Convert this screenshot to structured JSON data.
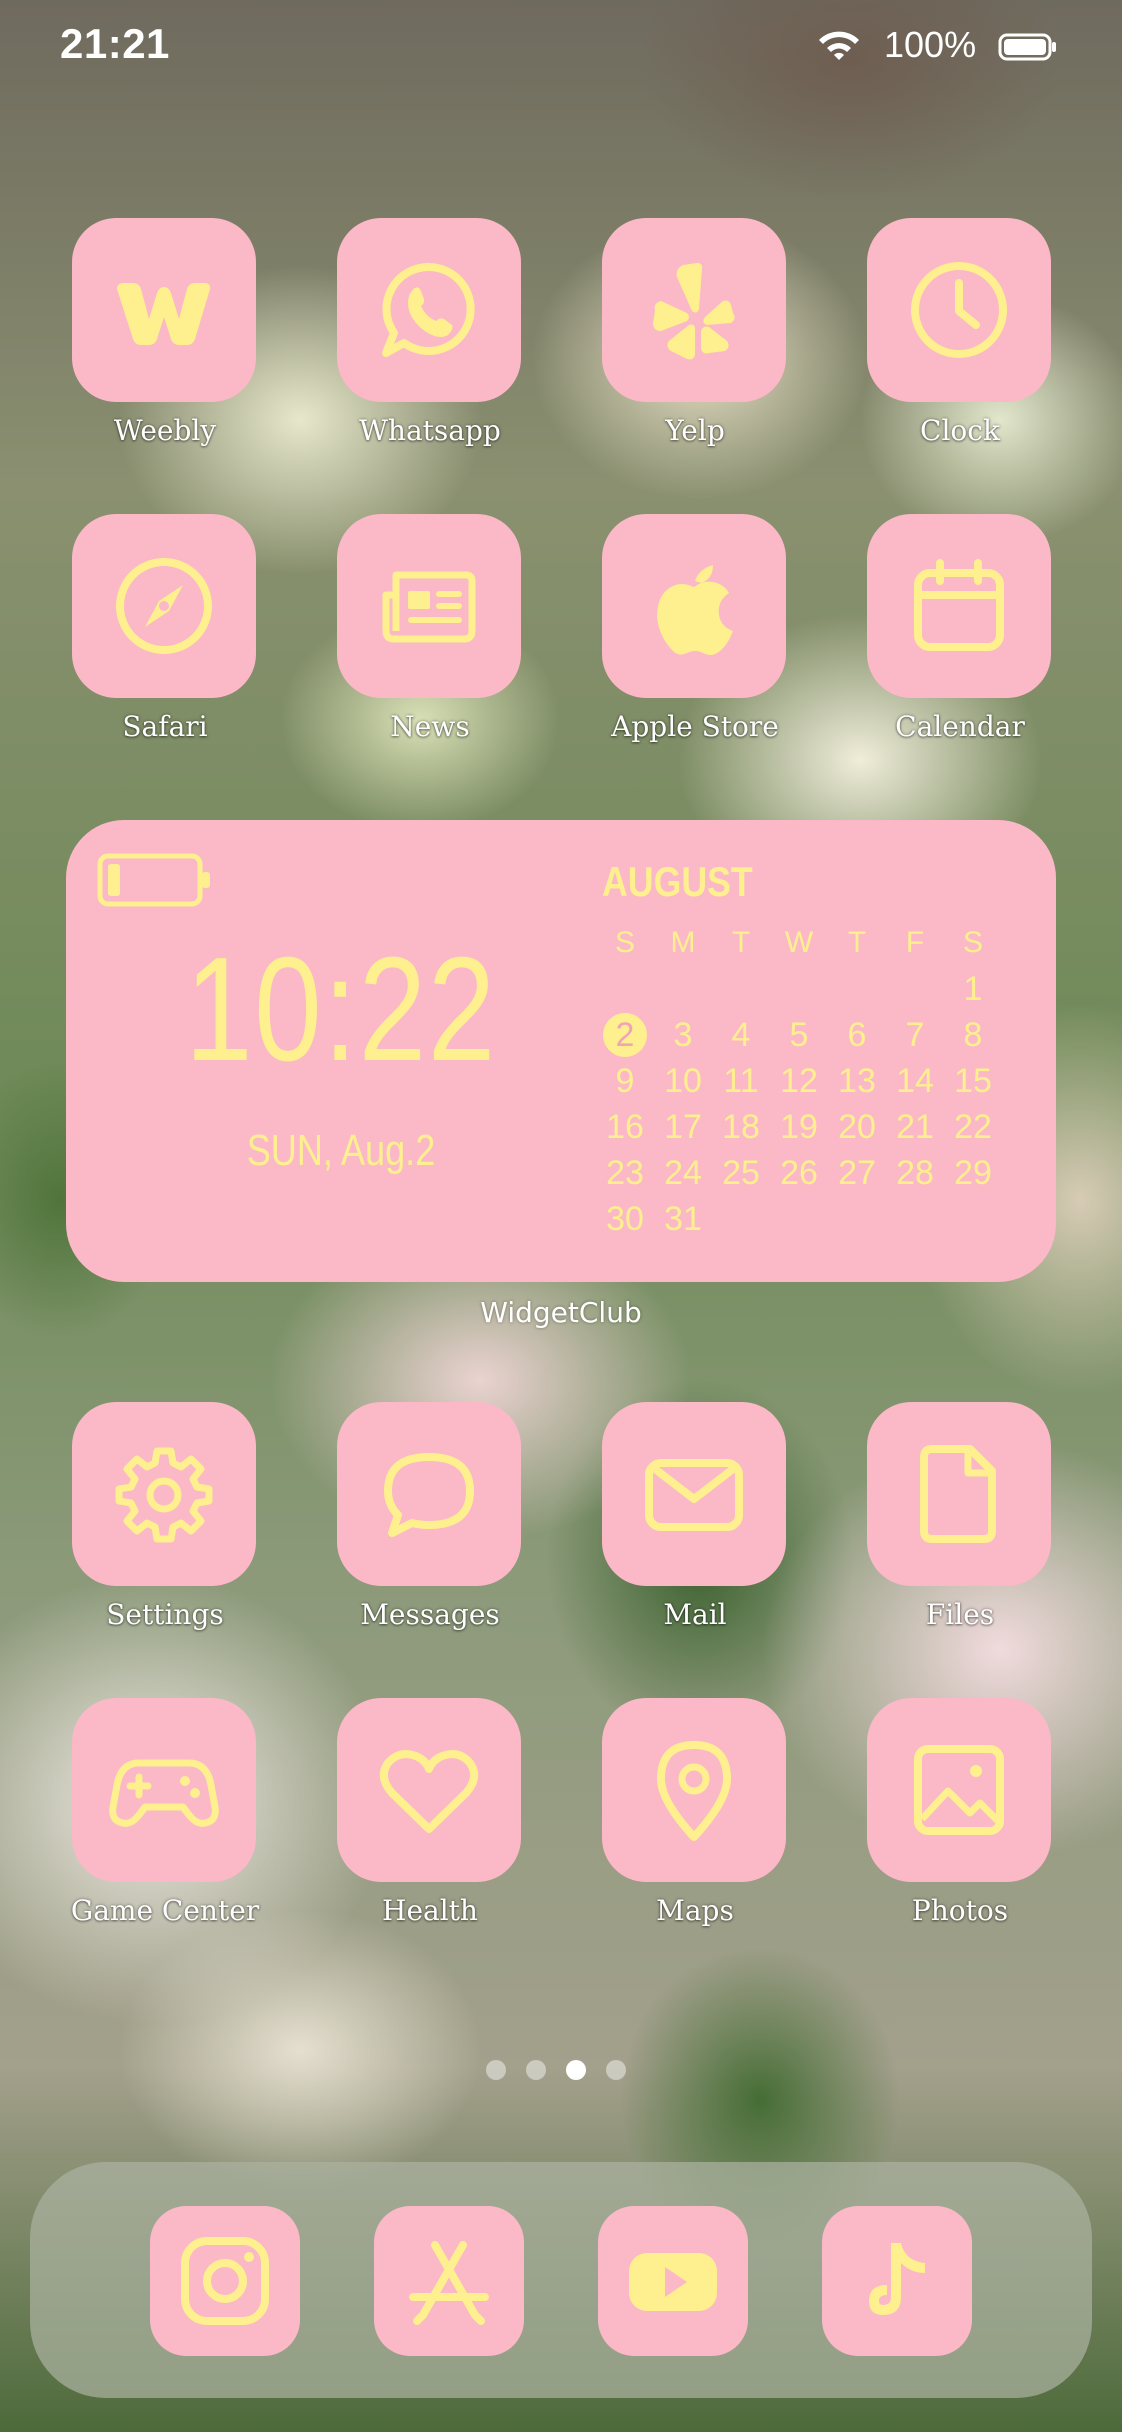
{
  "status_bar": {
    "time": "21:21",
    "battery_percent": "100%"
  },
  "colors": {
    "tile": "#fbb8c6",
    "glyph": "#fef08f",
    "label": "#ffffff"
  },
  "apps_row1": [
    {
      "label": "Weebly",
      "icon": "weebly-icon"
    },
    {
      "label": "Whatsapp",
      "icon": "whatsapp-icon"
    },
    {
      "label": "Yelp",
      "icon": "yelp-icon"
    },
    {
      "label": "Clock",
      "icon": "clock-icon"
    }
  ],
  "apps_row2": [
    {
      "label": "Safari",
      "icon": "compass-icon"
    },
    {
      "label": "News",
      "icon": "newspaper-icon"
    },
    {
      "label": "Apple Store",
      "icon": "apple-icon"
    },
    {
      "label": "Calendar",
      "icon": "calendar-icon"
    }
  ],
  "widget": {
    "label": "WidgetClub",
    "time": "10:22",
    "date": "SUN, Aug.2",
    "battery_icon": "battery-low-icon",
    "calendar": {
      "month": "AUGUST",
      "weekdays": [
        "S",
        "M",
        "T",
        "W",
        "T",
        "F",
        "S"
      ],
      "weeks": [
        [
          "",
          "",
          "",
          "",
          "",
          "",
          "1"
        ],
        [
          "2",
          "3",
          "4",
          "5",
          "6",
          "7",
          "8"
        ],
        [
          "9",
          "10",
          "11",
          "12",
          "13",
          "14",
          "15"
        ],
        [
          "16",
          "17",
          "18",
          "19",
          "20",
          "21",
          "22"
        ],
        [
          "23",
          "24",
          "25",
          "26",
          "27",
          "28",
          "29"
        ],
        [
          "30",
          "31",
          "",
          "",
          "",
          "",
          ""
        ]
      ],
      "today": "2"
    }
  },
  "apps_row3": [
    {
      "label": "Settings",
      "icon": "gear-icon"
    },
    {
      "label": "Messages",
      "icon": "chat-bubble-icon"
    },
    {
      "label": "Mail",
      "icon": "envelope-icon"
    },
    {
      "label": "Files",
      "icon": "file-icon"
    }
  ],
  "apps_row4": [
    {
      "label": "Game Center",
      "icon": "gamepad-icon"
    },
    {
      "label": "Health",
      "icon": "heart-icon"
    },
    {
      "label": "Maps",
      "icon": "map-pin-icon"
    },
    {
      "label": "Photos",
      "icon": "photo-icon"
    }
  ],
  "page_indicator": {
    "count": 4,
    "active": 3
  },
  "dock": [
    {
      "icon": "instagram-icon"
    },
    {
      "icon": "app-store-icon"
    },
    {
      "icon": "youtube-icon"
    },
    {
      "icon": "tiktok-icon"
    }
  ]
}
